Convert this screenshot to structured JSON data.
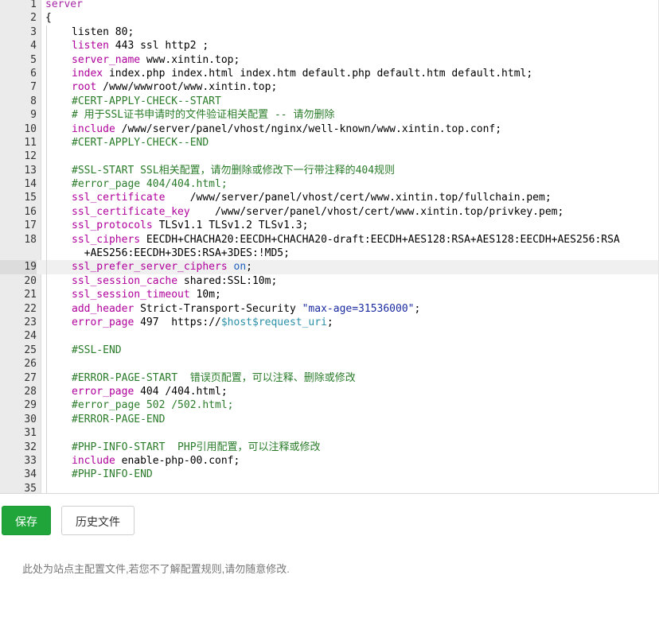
{
  "editor": {
    "lines": [
      {
        "n": "1",
        "indent": false,
        "tokens": [
          {
            "t": "server",
            "c": "kw"
          }
        ]
      },
      {
        "n": "2",
        "indent": false,
        "tokens": [
          {
            "t": "{",
            "c": ""
          }
        ]
      },
      {
        "n": "3",
        "indent": true,
        "tokens": [
          {
            "t": "listen 80;",
            "c": ""
          }
        ]
      },
      {
        "n": "4",
        "indent": true,
        "tokens": [
          {
            "t": "listen",
            "c": "kw2"
          },
          {
            "t": " 443 ssl http2 ;",
            "c": ""
          }
        ]
      },
      {
        "n": "5",
        "indent": true,
        "tokens": [
          {
            "t": "server_name",
            "c": "kw2"
          },
          {
            "t": " www.xintin.top;",
            "c": ""
          }
        ]
      },
      {
        "n": "6",
        "indent": true,
        "tokens": [
          {
            "t": "index",
            "c": "kw2"
          },
          {
            "t": " index.php index.html index.htm default.php default.htm default.html;",
            "c": ""
          }
        ]
      },
      {
        "n": "7",
        "indent": true,
        "tokens": [
          {
            "t": "root",
            "c": "kw2"
          },
          {
            "t": " /www/wwwroot/www.xintin.top;",
            "c": ""
          }
        ]
      },
      {
        "n": "8",
        "indent": true,
        "tokens": [
          {
            "t": "#CERT-APPLY-CHECK--START",
            "c": "cm"
          }
        ]
      },
      {
        "n": "9",
        "indent": true,
        "tokens": [
          {
            "t": "# 用于SSL证书申请时的文件验证相关配置 -- 请勿删除",
            "c": "cm"
          }
        ]
      },
      {
        "n": "10",
        "indent": true,
        "tokens": [
          {
            "t": "include",
            "c": "kw2"
          },
          {
            "t": " /www/server/panel/vhost/nginx/well-known/www.xintin.top.conf;",
            "c": ""
          }
        ]
      },
      {
        "n": "11",
        "indent": true,
        "tokens": [
          {
            "t": "#CERT-APPLY-CHECK--END",
            "c": "cm"
          }
        ]
      },
      {
        "n": "12",
        "indent": true,
        "tokens": []
      },
      {
        "n": "13",
        "indent": true,
        "tokens": [
          {
            "t": "#SSL-START SSL相关配置，请勿删除或修改下一行带注释的404规则",
            "c": "cm"
          }
        ]
      },
      {
        "n": "14",
        "indent": true,
        "tokens": [
          {
            "t": "#error_page 404/404.html;",
            "c": "cm"
          }
        ]
      },
      {
        "n": "15",
        "indent": true,
        "tokens": [
          {
            "t": "ssl_certificate",
            "c": "kw2"
          },
          {
            "t": "    /www/server/panel/vhost/cert/www.xintin.top/fullchain.pem;",
            "c": ""
          }
        ]
      },
      {
        "n": "16",
        "indent": true,
        "tokens": [
          {
            "t": "ssl_certificate_key",
            "c": "kw2"
          },
          {
            "t": "    /www/server/panel/vhost/cert/www.xintin.top/privkey.pem;",
            "c": ""
          }
        ]
      },
      {
        "n": "17",
        "indent": true,
        "tokens": [
          {
            "t": "ssl_protocols",
            "c": "kw2"
          },
          {
            "t": " TLSv1.1 TLSv1.2 TLSv1.3;",
            "c": ""
          }
        ]
      },
      {
        "n": "18",
        "indent": true,
        "wrap": true,
        "tokens": [
          {
            "t": "ssl_ciphers",
            "c": "kw2"
          },
          {
            "t": " EECDH+CHACHA20:EECDH+CHACHA20-draft:EECDH+AES128:RSA+AES128:EECDH+AES256:RSA",
            "c": ""
          }
        ],
        "wrap_tokens": [
          {
            "t": "  +AES256:EECDH+3DES:RSA+3DES:!MD5;",
            "c": ""
          }
        ]
      },
      {
        "n": "19",
        "indent": true,
        "active": true,
        "tokens": [
          {
            "t": "ssl_prefer_server_ciphers",
            "c": "kw2"
          },
          {
            "t": " ",
            "c": ""
          },
          {
            "t": "on",
            "c": "on"
          },
          {
            "t": ";",
            "c": ""
          }
        ]
      },
      {
        "n": "20",
        "indent": true,
        "tokens": [
          {
            "t": "ssl_session_cache",
            "c": "kw2"
          },
          {
            "t": " shared:SSL:10m;",
            "c": ""
          }
        ]
      },
      {
        "n": "21",
        "indent": true,
        "tokens": [
          {
            "t": "ssl_session_timeout",
            "c": "kw2"
          },
          {
            "t": " 10m;",
            "c": ""
          }
        ]
      },
      {
        "n": "22",
        "indent": true,
        "tokens": [
          {
            "t": "add_header",
            "c": "kw2"
          },
          {
            "t": " Strict-Transport-Security ",
            "c": ""
          },
          {
            "t": "\"max-age=31536000\"",
            "c": "str"
          },
          {
            "t": ";",
            "c": ""
          }
        ]
      },
      {
        "n": "23",
        "indent": true,
        "tokens": [
          {
            "t": "error_page",
            "c": "kw2"
          },
          {
            "t": " 497  https://",
            "c": ""
          },
          {
            "t": "$host$request_uri",
            "c": "var"
          },
          {
            "t": ";",
            "c": ""
          }
        ]
      },
      {
        "n": "24",
        "indent": true,
        "tokens": []
      },
      {
        "n": "25",
        "indent": true,
        "tokens": [
          {
            "t": "#SSL-END",
            "c": "cm"
          }
        ]
      },
      {
        "n": "26",
        "indent": true,
        "tokens": []
      },
      {
        "n": "27",
        "indent": true,
        "tokens": [
          {
            "t": "#ERROR-PAGE-START  错误页配置，可以注释、删除或修改",
            "c": "cm"
          }
        ]
      },
      {
        "n": "28",
        "indent": true,
        "tokens": [
          {
            "t": "error_page",
            "c": "kw2"
          },
          {
            "t": " 404 /404.html;",
            "c": ""
          }
        ]
      },
      {
        "n": "29",
        "indent": true,
        "tokens": [
          {
            "t": "#error_page 502 /502.html;",
            "c": "cm"
          }
        ]
      },
      {
        "n": "30",
        "indent": true,
        "tokens": [
          {
            "t": "#ERROR-PAGE-END",
            "c": "cm"
          }
        ]
      },
      {
        "n": "31",
        "indent": true,
        "tokens": []
      },
      {
        "n": "32",
        "indent": true,
        "tokens": [
          {
            "t": "#PHP-INFO-START  PHP引用配置，可以注释或修改",
            "c": "cm"
          }
        ]
      },
      {
        "n": "33",
        "indent": true,
        "tokens": [
          {
            "t": "include",
            "c": "kw2"
          },
          {
            "t": " enable-php-00.conf;",
            "c": ""
          }
        ]
      },
      {
        "n": "34",
        "indent": true,
        "tokens": [
          {
            "t": "#PHP-INFO-END",
            "c": "cm"
          }
        ]
      },
      {
        "n": "35",
        "indent": true,
        "tokens": []
      }
    ]
  },
  "actions": {
    "save_label": "保存",
    "history_label": "历史文件"
  },
  "footer": {
    "note": "此处为站点主配置文件,若您不了解配置规则,请勿随意修改."
  },
  "colors": {
    "save_bg": "#20a53a",
    "gutter_bg": "#ebebeb",
    "keyword": "#b0009c",
    "comment": "#2a7c2a",
    "string": "#1a2aa0"
  }
}
